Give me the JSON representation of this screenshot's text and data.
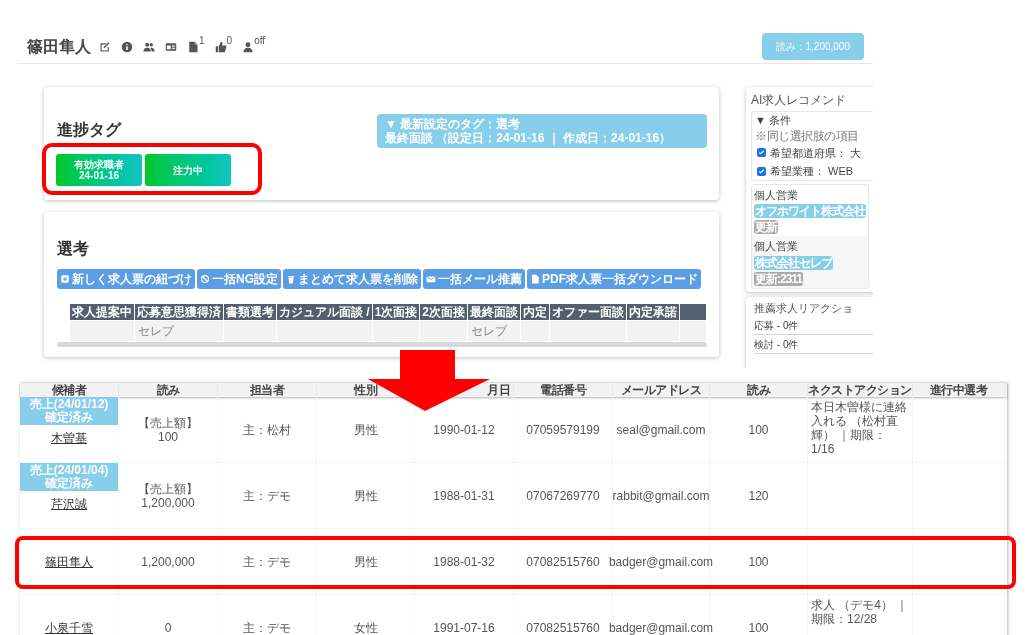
{
  "profile": {
    "name": "篠田隼人",
    "icons": [
      {
        "kind": "edit"
      },
      {
        "kind": "info"
      },
      {
        "kind": "users"
      },
      {
        "kind": "card"
      },
      {
        "kind": "document",
        "sup": "1"
      },
      {
        "kind": "thumb",
        "sup": "0"
      },
      {
        "kind": "person",
        "sup": "off"
      }
    ],
    "badge": "読み：1,200,000"
  },
  "progress_card": {
    "title": "進捗タグ",
    "latest": [
      "▼ 最新設定のタグ：選考",
      "最終面談 （設定日：24-01-16 ｜ 作成日：24-01-16）"
    ],
    "highlighted": true,
    "tags": [
      {
        "lines": [
          "有効求職者",
          "24-01-16"
        ]
      },
      {
        "lines": [
          "注力中"
        ]
      }
    ]
  },
  "selection_card": {
    "title": "選考",
    "buttons": [
      {
        "kind": "plus",
        "label": "新しく求人票の紐づけ"
      },
      {
        "kind": "ban",
        "label": "一括NG設定"
      },
      {
        "kind": "trash",
        "label": "まとめて求人票を削除"
      },
      {
        "kind": "mail",
        "label": "一括メール推薦"
      },
      {
        "kind": "file",
        "label": "PDF求人票一括ダウンロード"
      }
    ],
    "columns": [
      {
        "label": "求人提案中"
      },
      {
        "label": "応募意思獲得済",
        "cell": "セレブ"
      },
      {
        "label": "書類選考"
      },
      {
        "label": "カジュアル面談 /"
      },
      {
        "label": "1次面接"
      },
      {
        "label": "2次面接"
      },
      {
        "label": "最終面談",
        "cell": "セレブ"
      },
      {
        "label": "内定"
      },
      {
        "label": "オファー面談"
      },
      {
        "label": "内定承諾"
      }
    ]
  },
  "ai_card": {
    "title": "AI求人レコメンド",
    "conditions": {
      "label": "▼ 条件",
      "note": "※同じ選択肢の項目",
      "items": [
        {
          "label": "希望都道府県： 大",
          "checked": true
        },
        {
          "label": "希望業種： WEB",
          "checked": true
        }
      ]
    },
    "jobs": [
      {
        "title": "個人営業",
        "tags": [
          {
            "kind": "company",
            "text": "オフホワイト株式会社"
          },
          {
            "kind": "update",
            "text": "更新"
          }
        ]
      },
      {
        "title": "個人営業",
        "tags": [
          {
            "kind": "company",
            "text": "株式会社セレブ"
          },
          {
            "kind": "update",
            "text": "更新:2311"
          }
        ]
      }
    ]
  },
  "reaction_card": {
    "title": "推薦求人リアクショ",
    "items": [
      "応募 - 0件",
      "検討 - 0件"
    ]
  },
  "candidates": {
    "columns": [
      "候補者",
      "読み",
      "担当者",
      "性別",
      "月日",
      "電話番号",
      "メールアドレス",
      "読み",
      "ネクストアクション",
      "進行中選考"
    ],
    "rows": [
      {
        "badge": [
          "売上(24/01/12)",
          "確定済み"
        ],
        "name": "木曽基",
        "yomi": [
          "【売上額】",
          "100"
        ],
        "owner": "主：松村",
        "gender": "男性",
        "birth": "1990-01-12",
        "phone": "07059579199",
        "email": "seal@gmail.com",
        "score": "100",
        "next": "本日木曽様に連絡入れる （松村直輝） ｜期限：1/16",
        "highlighted": false
      },
      {
        "badge": [
          "売上(24/01/04)",
          "確定済み"
        ],
        "name": "芹沢誠",
        "yomi": [
          "【売上額】",
          "1,200,000"
        ],
        "owner": "主：デモ",
        "gender": "男性",
        "birth": "1988-01-31",
        "phone": "07067269770",
        "email": "rabbit@gmail.com",
        "score": "120",
        "highlighted": false
      },
      {
        "name": "篠田隼人",
        "yomi": [
          "1,200,000"
        ],
        "owner": "主：デモ",
        "gender": "男性",
        "birth": "1988-01-32",
        "phone": "07082515760",
        "email": "badger@gmail.com",
        "score": "100",
        "highlighted": true
      },
      {
        "name": "小泉千雪",
        "yomi": [
          "0"
        ],
        "owner": "主：デモ",
        "gender": "女性",
        "birth": "1991-07-16",
        "phone": "07082515760",
        "email": "badger@gmail.com",
        "score": "100",
        "next": "求人 （デモ4） ｜期限：12/28",
        "highlighted": false
      }
    ]
  }
}
